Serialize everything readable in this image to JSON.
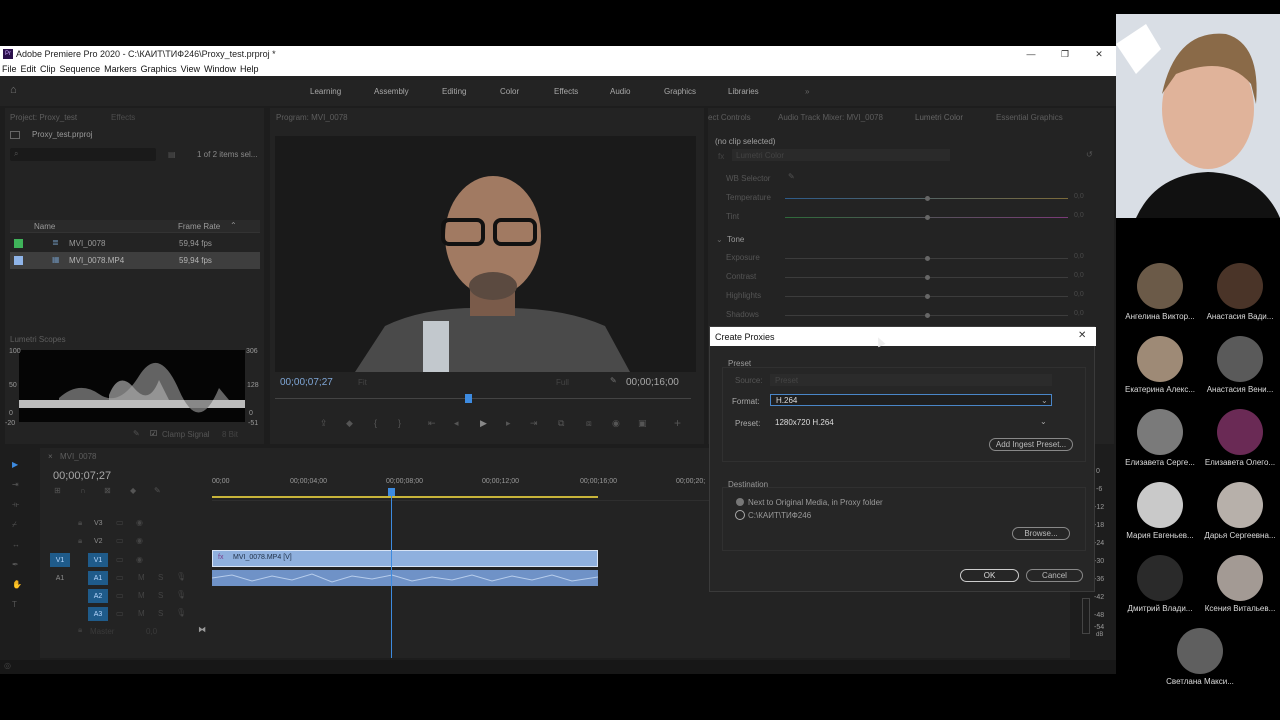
{
  "window": {
    "title": "Adobe Premiere Pro 2020 - C:\\КАИТ\\ТИФ246\\Proxy_test.prproj *",
    "app_icon": "Pr"
  },
  "menu": [
    "File",
    "Edit",
    "Clip",
    "Sequence",
    "Markers",
    "Graphics",
    "View",
    "Window",
    "Help"
  ],
  "workspaces": [
    "Learning",
    "Assembly",
    "Editing",
    "Color",
    "Effects",
    "Audio",
    "Graphics",
    "Libraries"
  ],
  "project": {
    "tab": "Project: Proxy_test",
    "tab2": "Effects",
    "file": "Proxy_test.prproj",
    "selection": "1 of 2 items sel...",
    "col_name": "Name",
    "col_rate": "Frame Rate",
    "items": [
      {
        "name": "MVI_0078",
        "rate": "59,94 fps",
        "color": "#3fb35a"
      },
      {
        "name": "MVI_0078.MP4",
        "rate": "59,94 fps",
        "color": "#8fb4e8"
      }
    ]
  },
  "scopes": {
    "tab": "Lumetri Scopes",
    "labels": [
      "100",
      "50",
      "0",
      "-20"
    ],
    "right_labels": [
      "306",
      "128",
      "0",
      "-51"
    ],
    "clamp": "Clamp Signal",
    "bit": "8 Bit"
  },
  "program": {
    "tab": "Program: MVI_0078",
    "timecode": "00;00;07;27",
    "fit": "Fit",
    "quality": "Full",
    "duration": "00;00;16;00"
  },
  "right_panel": {
    "tabs": [
      "ect Controls",
      "Audio Track Mixer: MVI_0078",
      "Lumetri Color",
      "Essential Graphics"
    ],
    "no_clip": "(no clip selected)",
    "fx": "Lumetri Color",
    "wb": "WB Selector",
    "sliders": [
      {
        "label": "Temperature",
        "value": "0,0"
      },
      {
        "label": "Tint",
        "value": "0,0"
      }
    ],
    "tone": "Tone",
    "tone_sliders": [
      {
        "label": "Exposure",
        "value": "0,0"
      },
      {
        "label": "Contrast",
        "value": "0,0"
      },
      {
        "label": "Highlights",
        "value": "0,0"
      },
      {
        "label": "Shadows",
        "value": "0,0"
      }
    ]
  },
  "dialog": {
    "title": "Create Proxies",
    "preset_group": "Preset",
    "source_label": "Source:",
    "source_value": "Preset",
    "format_label": "Format:",
    "format_value": "H.264",
    "preset_label": "Preset:",
    "preset_value": "1280x720 H.264",
    "add_ingest": "Add Ingest Preset...",
    "dest_group": "Destination",
    "dest_opt1": "Next to Original Media, in Proxy folder",
    "dest_opt2": "C:\\КАИТ\\ТИФ246",
    "browse": "Browse...",
    "ok": "OK",
    "cancel": "Cancel"
  },
  "timeline": {
    "tab": "MVI_0078",
    "timecode": "00;00;07;27",
    "ruler": [
      "00;00",
      "00;00;04;00",
      "00;00;08;00",
      "00;00;12;00",
      "00;00;16;00",
      "00;00;20;"
    ],
    "tracks_video": [
      "V3",
      "V2",
      "V1"
    ],
    "tracks_audio": [
      "A1",
      "A2",
      "A3"
    ],
    "master": "Master",
    "master_val": "0,0",
    "clip_label": "MVI_0078.MP4 [V]",
    "v1_src": "V1",
    "a1_src": "A1",
    "meter": [
      "0",
      "-6",
      "-12",
      "-18",
      "-24",
      "-30",
      "-36",
      "-42",
      "-48",
      "-54",
      "dB"
    ]
  },
  "participants": [
    "Ангелина Виктор...",
    "Анастасия Вади...",
    "Екатерина Алекс...",
    "Анастасия Вени...",
    "Елизавета Серге...",
    "Елизавета Олего...",
    "Мария Евгеньев...",
    "Дарья Сергеевна...",
    "Дмитрий Влади...",
    "Ксения Витальев...",
    "Светлана Макси..."
  ]
}
